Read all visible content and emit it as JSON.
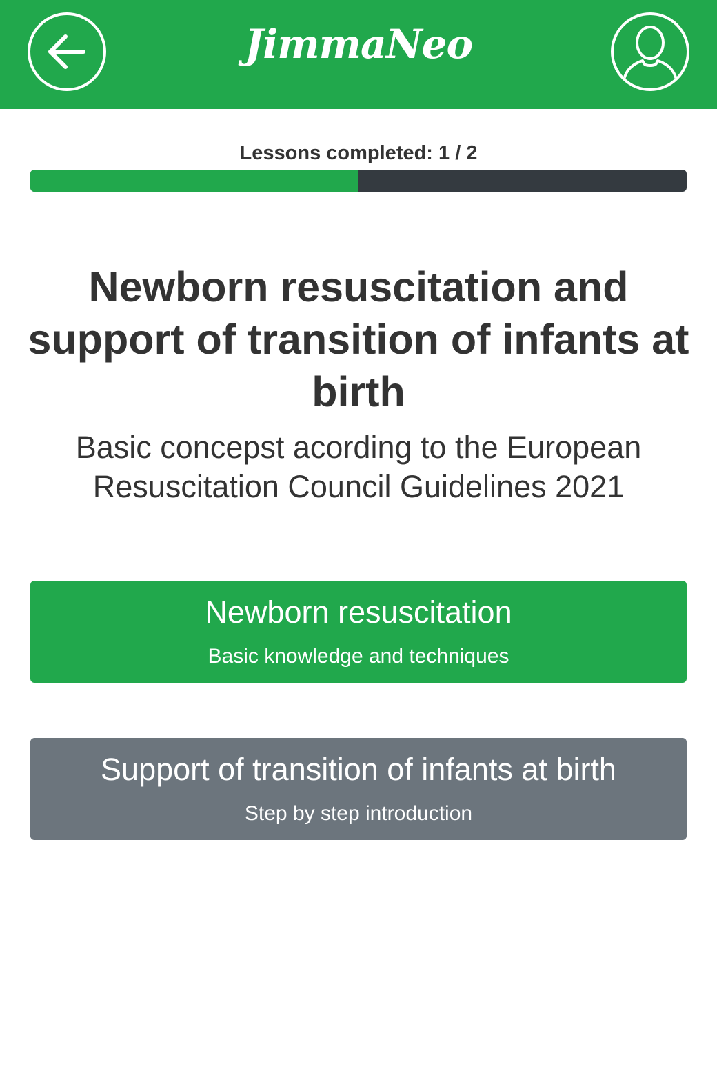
{
  "header": {
    "app_name": "JimmaNeo",
    "back_icon": "arrow-left-icon",
    "profile_icon": "user-profile-icon",
    "background_color": "#21a84c"
  },
  "progress": {
    "label": "Lessons completed: 1 / 2",
    "completed": 1,
    "total": 2,
    "fill_color": "#21a84c",
    "track_color": "#343a40"
  },
  "page": {
    "title": "Newborn resuscitation and support of transition of infants at birth",
    "subtitle": "Basic concepst acording to the European Resuscitation Council Guidelines 2021"
  },
  "lessons": [
    {
      "title": "Newborn resuscitation",
      "subtitle": "Basic knowledge and techniques",
      "color": "#21a84c",
      "completed": true
    },
    {
      "title": "Support of transition of infants at birth",
      "subtitle": "Step by step introduction",
      "color": "#6c757d",
      "completed": false
    }
  ]
}
